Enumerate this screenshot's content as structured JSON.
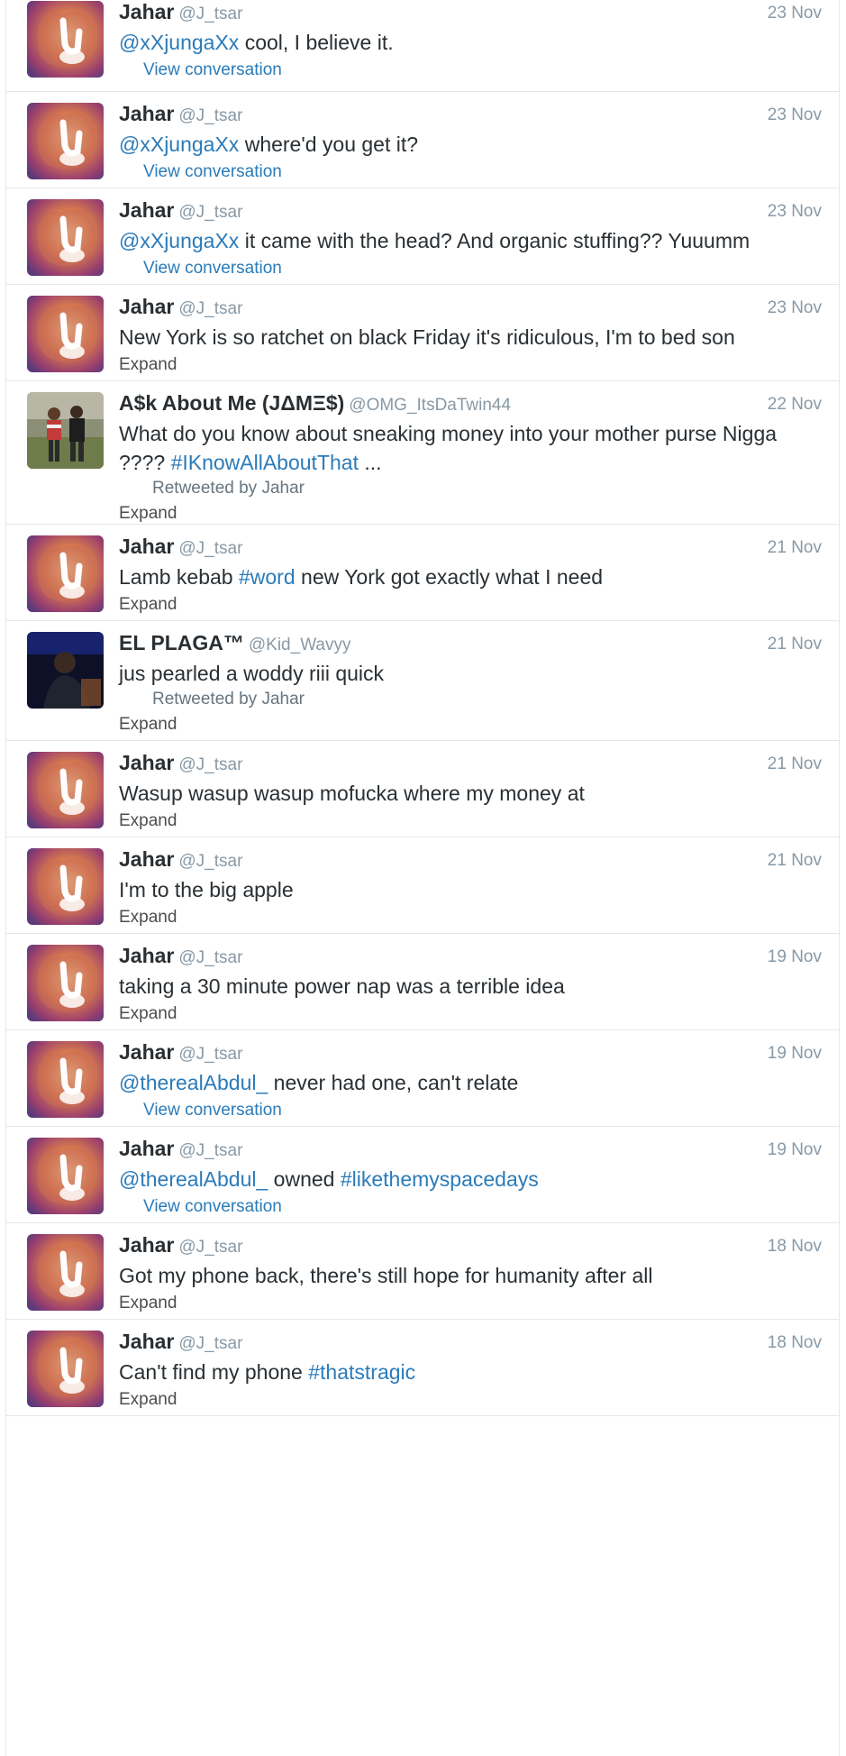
{
  "tweets": [
    {
      "fullname": "Jahar",
      "username": "@J_tsar",
      "time": "23 Nov",
      "parts": [
        {
          "t": "@xXjungaXx",
          "link": true
        },
        {
          "t": " cool, I believe it.",
          "link": false
        }
      ],
      "retweeted_by": null,
      "action": "View conversation",
      "avatar": "lion-avatar"
    },
    {
      "fullname": "Jahar",
      "username": "@J_tsar",
      "time": "23 Nov",
      "parts": [
        {
          "t": "@xXjungaXx",
          "link": true
        },
        {
          "t": " where'd you get it?",
          "link": false
        }
      ],
      "retweeted_by": null,
      "action": "View conversation",
      "avatar": "lion-avatar"
    },
    {
      "fullname": "Jahar",
      "username": "@J_tsar",
      "time": "23 Nov",
      "parts": [
        {
          "t": "@xXjungaXx",
          "link": true
        },
        {
          "t": " it came with the head? And organic stuffing?? Yuuumm",
          "link": false
        }
      ],
      "retweeted_by": null,
      "action": "View conversation",
      "avatar": "lion-avatar"
    },
    {
      "fullname": "Jahar",
      "username": "@J_tsar",
      "time": "23 Nov",
      "parts": [
        {
          "t": "New York is so ratchet on black Friday it's ridiculous, I'm to bed son",
          "link": false
        }
      ],
      "retweeted_by": null,
      "action": "Expand",
      "avatar": "lion-avatar"
    },
    {
      "fullname": "A$k About Me (JΔMΞ$)",
      "username": "@OMG_ItsDaTwin44",
      "time": "22 Nov",
      "parts": [
        {
          "t": "What do you know about sneaking money into your mother purse Nigga ???? ",
          "link": false
        },
        {
          "t": "#IKnowAllAboutThat",
          "link": true
        },
        {
          "t": " ...",
          "link": false
        }
      ],
      "retweeted_by": "Retweeted by Jahar",
      "action": "Expand",
      "avatar": "photo-avatar"
    },
    {
      "fullname": "Jahar",
      "username": "@J_tsar",
      "time": "21 Nov",
      "parts": [
        {
          "t": "Lamb kebab ",
          "link": false
        },
        {
          "t": "#word",
          "link": true
        },
        {
          "t": " new York got exactly what I need",
          "link": false
        }
      ],
      "retweeted_by": null,
      "action": "Expand",
      "avatar": "lion-avatar"
    },
    {
      "fullname": "EL PLAGA™",
      "username": "@Kid_Wavyy",
      "time": "21 Nov",
      "parts": [
        {
          "t": "jus pearled a woddy riii quick",
          "link": false
        }
      ],
      "retweeted_by": "Retweeted by Jahar",
      "action": "Expand",
      "avatar": "dark-photo-avatar"
    },
    {
      "fullname": "Jahar",
      "username": "@J_tsar",
      "time": "21 Nov",
      "parts": [
        {
          "t": "Wasup wasup wasup mofucka where my money at",
          "link": false
        }
      ],
      "retweeted_by": null,
      "action": "Expand",
      "avatar": "lion-avatar"
    },
    {
      "fullname": "Jahar",
      "username": "@J_tsar",
      "time": "21 Nov",
      "parts": [
        {
          "t": "I'm to the big apple",
          "link": false
        }
      ],
      "retweeted_by": null,
      "action": "Expand",
      "avatar": "lion-avatar"
    },
    {
      "fullname": "Jahar",
      "username": "@J_tsar",
      "time": "19 Nov",
      "parts": [
        {
          "t": "taking a 30 minute power nap was a terrible idea",
          "link": false
        }
      ],
      "retweeted_by": null,
      "action": "Expand",
      "avatar": "lion-avatar"
    },
    {
      "fullname": "Jahar",
      "username": "@J_tsar",
      "time": "19 Nov",
      "parts": [
        {
          "t": "@therealAbdul_",
          "link": true
        },
        {
          "t": " never had one, can't relate",
          "link": false
        }
      ],
      "retweeted_by": null,
      "action": "View conversation",
      "avatar": "lion-avatar"
    },
    {
      "fullname": "Jahar",
      "username": "@J_tsar",
      "time": "19 Nov",
      "parts": [
        {
          "t": "@therealAbdul_",
          "link": true
        },
        {
          "t": " owned ",
          "link": false
        },
        {
          "t": "#likethemyspacedays",
          "link": true
        }
      ],
      "retweeted_by": null,
      "action": "View conversation",
      "avatar": "lion-avatar"
    },
    {
      "fullname": "Jahar",
      "username": "@J_tsar",
      "time": "18 Nov",
      "parts": [
        {
          "t": "Got my phone back, there's still hope for humanity after all",
          "link": false
        }
      ],
      "retweeted_by": null,
      "action": "Expand",
      "avatar": "lion-avatar"
    },
    {
      "fullname": "Jahar",
      "username": "@J_tsar",
      "time": "18 Nov",
      "parts": [
        {
          "t": "Can't find my phone ",
          "link": false
        },
        {
          "t": "#thatstragic",
          "link": true
        }
      ],
      "retweeted_by": null,
      "action": "Expand",
      "avatar": "lion-avatar"
    }
  ]
}
